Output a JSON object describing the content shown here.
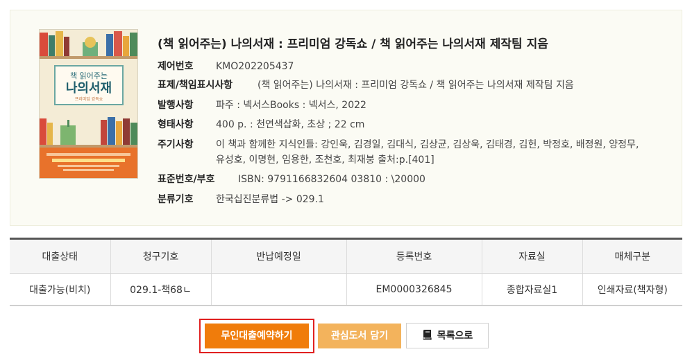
{
  "record": {
    "title": "(책 읽어주는) 나의서재 : 프리미엄 강독쇼 / 책 읽어주는 나의서재 제작팀 지음",
    "cover": {
      "title_small": "책 읽어주는",
      "title_big": "나의서재",
      "subtitle": "프리미엄 강독쇼"
    },
    "fields": [
      {
        "label": "제어번호",
        "value": "KMO202205437"
      },
      {
        "label": "표제/책임표시사항",
        "value": "(책 읽어주는) 나의서재 : 프리미엄 강독쇼 / 책 읽어주는 나의서재 제작팀 지음"
      },
      {
        "label": "발행사항",
        "value": "파주 : 넥서스Books : 넥서스, 2022"
      },
      {
        "label": "형태사항",
        "value": "400 p. : 천연색삽화, 초상 ; 22 cm"
      },
      {
        "label": "주기사항",
        "value": "이 책과 함께한 지식인들: 강인욱, 김경일, 김대식, 김상균, 김상욱, 김태경, 김헌, 박정호, 배정원, 양정무, 유성호, 이명현, 임용한, 조천호, 최재붕 출처:p.[401]"
      },
      {
        "label": "표준번호/부호",
        "value": "ISBN: 9791166832604 03810 : \\20000"
      },
      {
        "label": "분류기호",
        "value": "한국십진분류법 -> 029.1"
      }
    ]
  },
  "holdings": {
    "headers": [
      "대출상태",
      "청구기호",
      "반납예정일",
      "등록번호",
      "자료실",
      "매체구분"
    ],
    "rows": [
      [
        "대출가능(비치)",
        "029.1-책68ㄴ",
        "",
        "EM0000326845",
        "종합자료실1",
        "인쇄자료(책자형)"
      ]
    ]
  },
  "buttons": {
    "reserve": "무인대출예약하기",
    "interest": "관심도서 담기",
    "list": "목록으로",
    "list_icon": "book-icon"
  },
  "colors": {
    "reserve_bg": "#f07c0b",
    "interest_bg": "#f3b35c",
    "focus_outline": "#e02020",
    "table_top_border": "#555555"
  }
}
